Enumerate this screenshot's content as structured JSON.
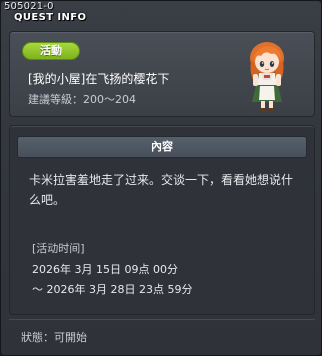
{
  "header": {
    "quest_id": "505021-0",
    "title": "QUEST INFO"
  },
  "quest": {
    "tag": "活動",
    "name": "[我的小屋]在飞扬的樱花下",
    "level": "建議等級：200～204"
  },
  "content": {
    "header": "內容",
    "description": "卡米拉害羞地走了过来。交谈一下，看看她想说什么吧。",
    "time_title": "[活动时间]",
    "time_start": "2026年 3月 15日 09点 00分",
    "time_end": "～ 2026年 3月 28日 23点 59分"
  },
  "footer": {
    "status": "狀態：可開始"
  },
  "colors": {
    "tag_green": "#8cc42a",
    "window_bg": "#34383f",
    "panel_bg": "#2f3238"
  }
}
